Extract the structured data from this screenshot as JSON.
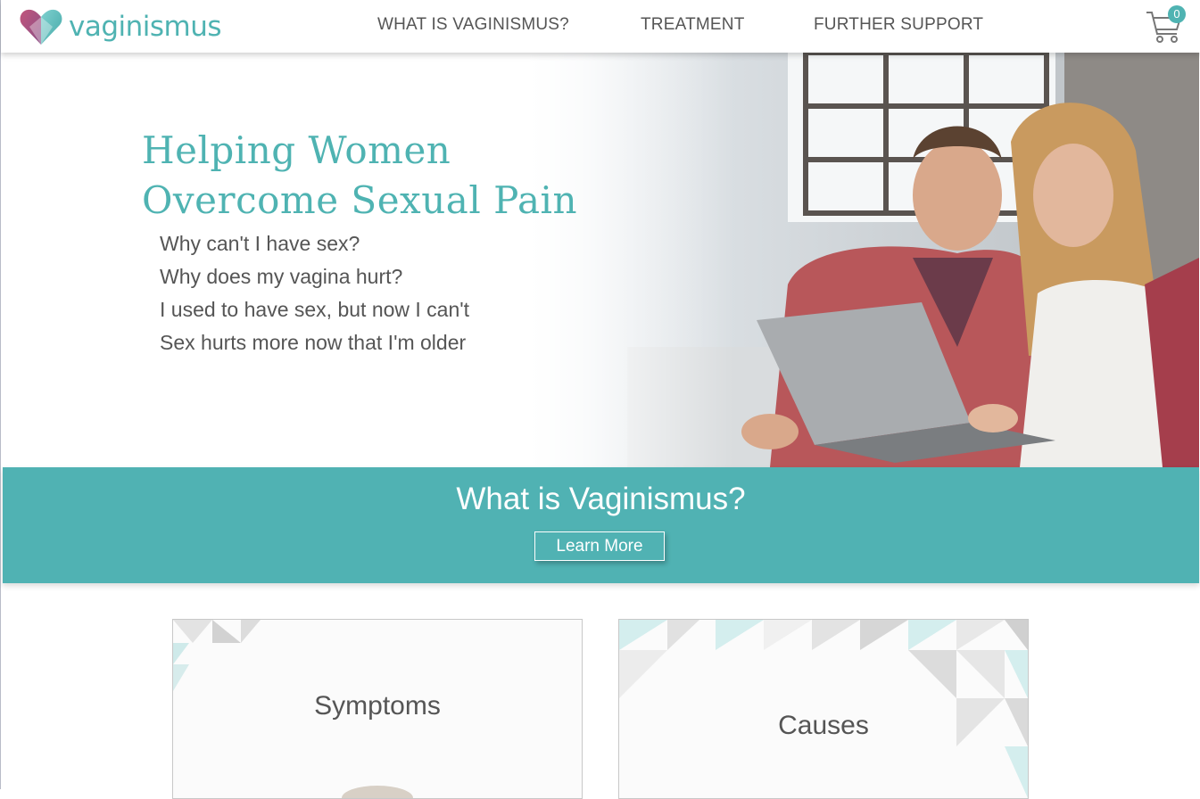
{
  "header": {
    "logo_text": "vaginismus",
    "nav": [
      "WHAT IS VAGINISMUS?",
      "TREATMENT",
      "FURTHER SUPPORT"
    ],
    "cart_count": "0",
    "cart_icon": "shopping-cart-icon"
  },
  "hero": {
    "title_line1": "Helping Women",
    "title_line2": "Overcome Sexual Pain",
    "questions": [
      "Why can't I have sex?",
      "Why does my vagina hurt?",
      "I used to have sex, but now I can't",
      "Sex hurts more now that I'm older"
    ]
  },
  "band": {
    "title": "What is Vaginismus?",
    "button_label": "Learn More"
  },
  "cards": [
    {
      "title": "Symptoms"
    },
    {
      "title": "Causes"
    }
  ],
  "colors": {
    "brand_teal": "#4fb3b2",
    "band_teal": "#50b2b3",
    "text_gray": "#555555",
    "logo_pink": "#c2557c"
  }
}
